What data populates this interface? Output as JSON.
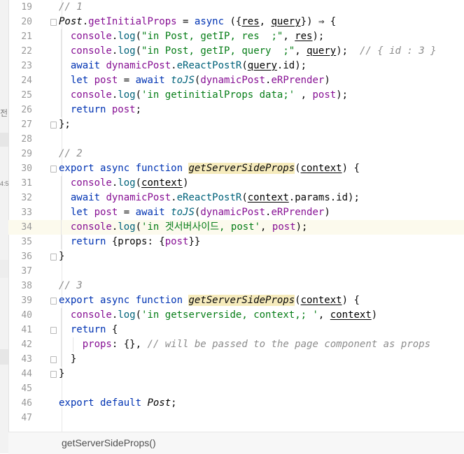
{
  "side_panel": {
    "text_top": "전",
    "text_mid": "4:5"
  },
  "breadcrumb": "getServerSideProps()",
  "lines": [
    {
      "num": "19",
      "indent": 0,
      "tokens": [
        {
          "t": "// 1",
          "c": "comment"
        }
      ]
    },
    {
      "num": "20",
      "indent": 0,
      "fold": true,
      "tokens": [
        {
          "t": "Post",
          "c": "cls"
        },
        {
          "t": "."
        },
        {
          "t": "getInitialProps",
          "c": "field"
        },
        {
          "t": " = "
        },
        {
          "t": "async",
          "c": "kw"
        },
        {
          "t": " ({"
        },
        {
          "t": "res",
          "c": "var"
        },
        {
          "t": ", "
        },
        {
          "t": "query",
          "c": "var"
        },
        {
          "t": "}) ⇒ {"
        }
      ]
    },
    {
      "num": "21",
      "indent": 1,
      "tokens": [
        {
          "t": "console",
          "c": "field"
        },
        {
          "t": "."
        },
        {
          "t": "log",
          "c": "fn"
        },
        {
          "t": "("
        },
        {
          "t": "\"in Post, getIP, res  ;\"",
          "c": "str"
        },
        {
          "t": ", "
        },
        {
          "t": "res",
          "c": "var"
        },
        {
          "t": ");"
        }
      ]
    },
    {
      "num": "22",
      "indent": 1,
      "tokens": [
        {
          "t": "console",
          "c": "field"
        },
        {
          "t": "."
        },
        {
          "t": "log",
          "c": "fn"
        },
        {
          "t": "("
        },
        {
          "t": "\"in Post, getIP, query  ;\"",
          "c": "str"
        },
        {
          "t": ", "
        },
        {
          "t": "query",
          "c": "var"
        },
        {
          "t": ");  "
        },
        {
          "t": "// { id : 3 }",
          "c": "comment"
        }
      ]
    },
    {
      "num": "23",
      "indent": 1,
      "tokens": [
        {
          "t": "await ",
          "c": "kw"
        },
        {
          "t": "dynamicPost",
          "c": "field"
        },
        {
          "t": "."
        },
        {
          "t": "eReactPostR",
          "c": "fn"
        },
        {
          "t": "("
        },
        {
          "t": "query",
          "c": "var"
        },
        {
          "t": ".id);"
        }
      ]
    },
    {
      "num": "24",
      "indent": 1,
      "tokens": [
        {
          "t": "let ",
          "c": "kw"
        },
        {
          "t": "post",
          "c": "field"
        },
        {
          "t": " = "
        },
        {
          "t": "await ",
          "c": "kw"
        },
        {
          "t": "toJS",
          "c": "ifn"
        },
        {
          "t": "("
        },
        {
          "t": "dynamicPost",
          "c": "field"
        },
        {
          "t": "."
        },
        {
          "t": "eRPrender",
          "c": "field"
        },
        {
          "t": ")"
        }
      ]
    },
    {
      "num": "25",
      "indent": 1,
      "tokens": [
        {
          "t": "console",
          "c": "field"
        },
        {
          "t": "."
        },
        {
          "t": "log",
          "c": "fn"
        },
        {
          "t": "("
        },
        {
          "t": "'in getinitialProps data;'",
          "c": "str"
        },
        {
          "t": " , "
        },
        {
          "t": "post",
          "c": "field"
        },
        {
          "t": ");"
        }
      ]
    },
    {
      "num": "26",
      "indent": 1,
      "tokens": [
        {
          "t": "return ",
          "c": "kw"
        },
        {
          "t": "post",
          "c": "field"
        },
        {
          "t": ";"
        }
      ]
    },
    {
      "num": "27",
      "indent": 0,
      "fold": true,
      "tokens": [
        {
          "t": "};"
        }
      ]
    },
    {
      "num": "28",
      "indent": 0,
      "tokens": []
    },
    {
      "num": "29",
      "indent": 0,
      "tokens": [
        {
          "t": "// 2",
          "c": "comment"
        }
      ]
    },
    {
      "num": "30",
      "indent": 0,
      "fold": true,
      "tokens": [
        {
          "t": "export async function ",
          "c": "kw"
        },
        {
          "t": "getServerSideProps",
          "c": "decl"
        },
        {
          "t": "("
        },
        {
          "t": "context",
          "c": "var"
        },
        {
          "t": ") {"
        }
      ]
    },
    {
      "num": "31",
      "indent": 1,
      "tokens": [
        {
          "t": "console",
          "c": "field"
        },
        {
          "t": "."
        },
        {
          "t": "log",
          "c": "fn"
        },
        {
          "t": "("
        },
        {
          "t": "context",
          "c": "var"
        },
        {
          "t": ")"
        }
      ]
    },
    {
      "num": "32",
      "indent": 1,
      "tokens": [
        {
          "t": "await ",
          "c": "kw"
        },
        {
          "t": "dynamicPost",
          "c": "field"
        },
        {
          "t": "."
        },
        {
          "t": "eReactPostR",
          "c": "fn"
        },
        {
          "t": "("
        },
        {
          "t": "context",
          "c": "var"
        },
        {
          "t": ".params.id);"
        }
      ]
    },
    {
      "num": "33",
      "indent": 1,
      "tokens": [
        {
          "t": "let ",
          "c": "kw"
        },
        {
          "t": "post",
          "c": "field"
        },
        {
          "t": " = "
        },
        {
          "t": "await ",
          "c": "kw"
        },
        {
          "t": "toJS",
          "c": "ifn"
        },
        {
          "t": "("
        },
        {
          "t": "dynamicPost",
          "c": "field"
        },
        {
          "t": "."
        },
        {
          "t": "eRPrender",
          "c": "field"
        },
        {
          "t": ")"
        }
      ]
    },
    {
      "num": "34",
      "indent": 1,
      "current": true,
      "tokens": [
        {
          "t": "console",
          "c": "field"
        },
        {
          "t": "."
        },
        {
          "t": "log",
          "c": "fn"
        },
        {
          "t": "("
        },
        {
          "t": "'in 겟서버사이드, post'",
          "c": "str"
        },
        {
          "t": ", "
        },
        {
          "t": "post",
          "c": "field"
        },
        {
          "t": ");"
        }
      ]
    },
    {
      "num": "35",
      "indent": 1,
      "tokens": [
        {
          "t": "return ",
          "c": "kw"
        },
        {
          "t": "{props: {"
        },
        {
          "t": "post",
          "c": "field"
        },
        {
          "t": "}}"
        }
      ]
    },
    {
      "num": "36",
      "indent": 0,
      "fold": true,
      "tokens": [
        {
          "t": "}"
        }
      ]
    },
    {
      "num": "37",
      "indent": 0,
      "tokens": []
    },
    {
      "num": "38",
      "indent": 0,
      "tokens": [
        {
          "t": "// 3",
          "c": "comment"
        }
      ]
    },
    {
      "num": "39",
      "indent": 0,
      "fold": true,
      "tokens": [
        {
          "t": "export async function ",
          "c": "kw"
        },
        {
          "t": "getServerSideProps",
          "c": "decl"
        },
        {
          "t": "("
        },
        {
          "t": "context",
          "c": "var"
        },
        {
          "t": ") {"
        }
      ]
    },
    {
      "num": "40",
      "indent": 1,
      "tokens": [
        {
          "t": "console",
          "c": "field"
        },
        {
          "t": "."
        },
        {
          "t": "log",
          "c": "fn"
        },
        {
          "t": "("
        },
        {
          "t": "'in getserverside, context,; '",
          "c": "str"
        },
        {
          "t": ", "
        },
        {
          "t": "context",
          "c": "var"
        },
        {
          "t": ")"
        }
      ]
    },
    {
      "num": "41",
      "indent": 1,
      "fold": true,
      "tokens": [
        {
          "t": "return ",
          "c": "kw"
        },
        {
          "t": "{"
        }
      ]
    },
    {
      "num": "42",
      "indent": 2,
      "tokens": [
        {
          "t": "props",
          "c": "field"
        },
        {
          "t": ": {}, "
        },
        {
          "t": "// will be passed to the page component as props",
          "c": "comment"
        }
      ]
    },
    {
      "num": "43",
      "indent": 1,
      "fold": true,
      "tokens": [
        {
          "t": "}"
        }
      ]
    },
    {
      "num": "44",
      "indent": 0,
      "fold": true,
      "tokens": [
        {
          "t": "}"
        }
      ]
    },
    {
      "num": "45",
      "indent": 0,
      "tokens": []
    },
    {
      "num": "46",
      "indent": 0,
      "tokens": [
        {
          "t": "export default ",
          "c": "kw"
        },
        {
          "t": "Post",
          "c": "cls"
        },
        {
          "t": ";"
        }
      ]
    },
    {
      "num": "47",
      "indent": 0,
      "tokens": []
    }
  ]
}
